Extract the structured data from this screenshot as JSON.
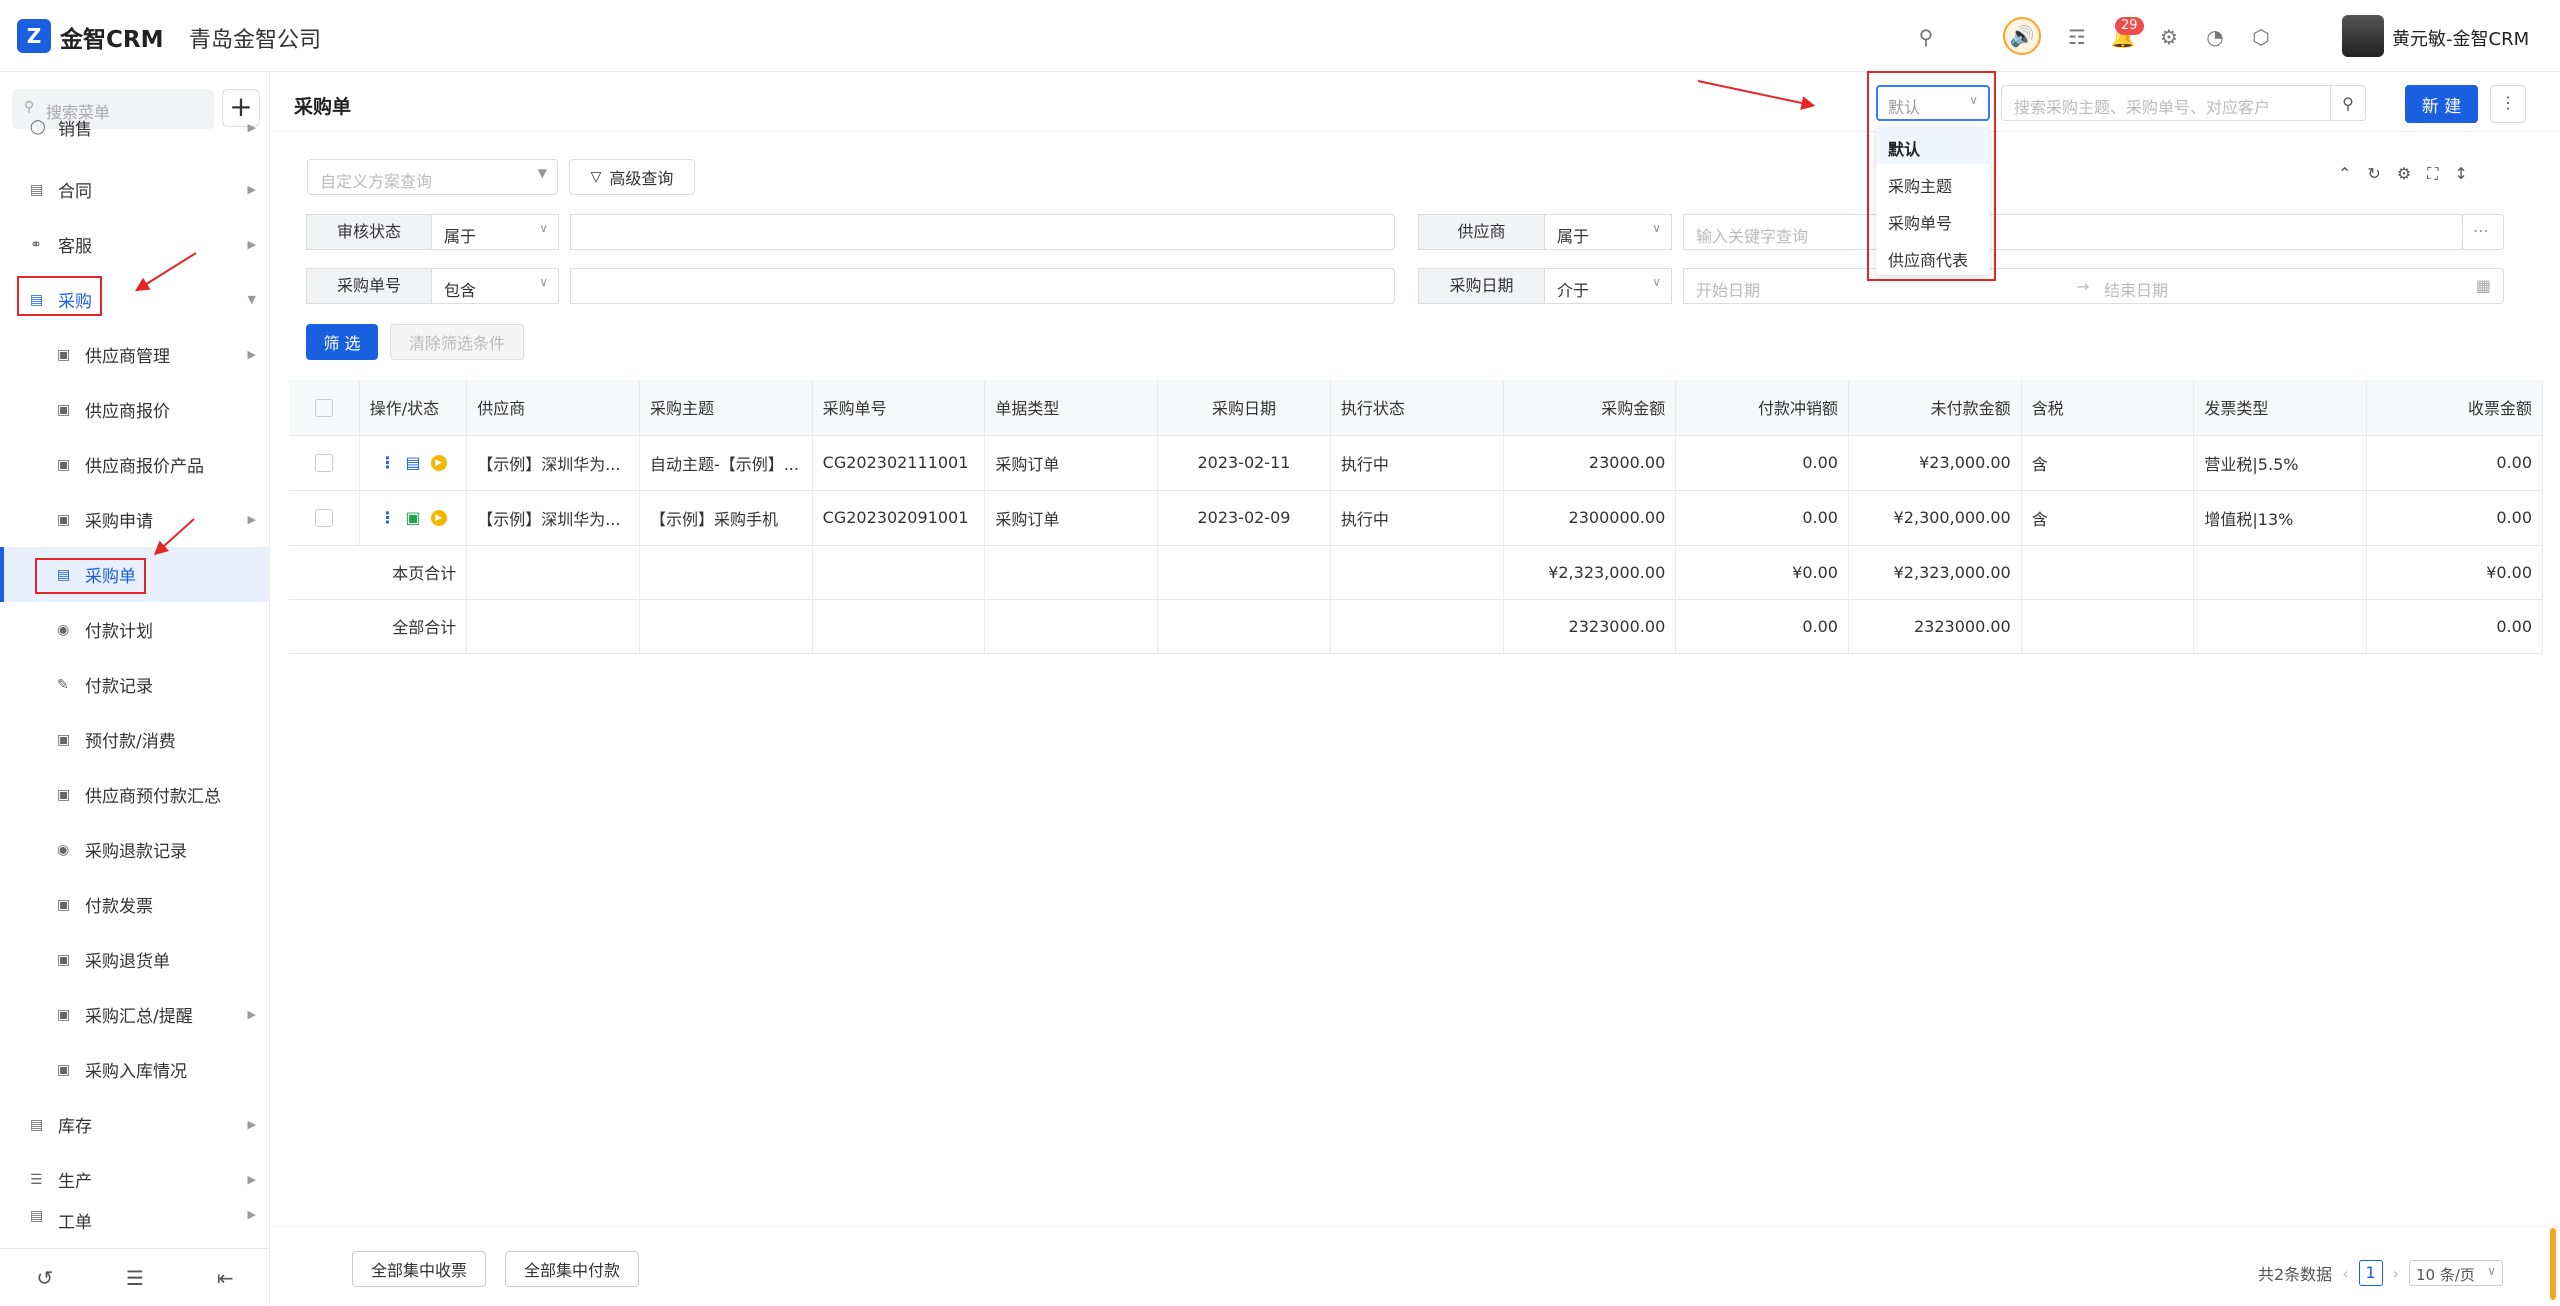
{
  "app": {
    "logo_letter": "Z",
    "name": "金智CRM",
    "company": "青岛金智公司",
    "notification_count": "29",
    "user_name": "黄元敏-金智CRM"
  },
  "sidebar": {
    "search_placeholder": "搜索菜单",
    "items": [
      {
        "label": "销售"
      },
      {
        "label": "合同"
      },
      {
        "label": "客服"
      },
      {
        "label": "采购"
      },
      {
        "label": "供应商管理"
      },
      {
        "label": "供应商报价"
      },
      {
        "label": "供应商报价产品"
      },
      {
        "label": "采购申请"
      },
      {
        "label": "采购单"
      },
      {
        "label": "付款计划"
      },
      {
        "label": "付款记录"
      },
      {
        "label": "预付款/消费"
      },
      {
        "label": "供应商预付款汇总"
      },
      {
        "label": "采购退款记录"
      },
      {
        "label": "付款发票"
      },
      {
        "label": "采购退货单"
      },
      {
        "label": "采购汇总/提醒"
      },
      {
        "label": "采购入库情况"
      },
      {
        "label": "库存"
      },
      {
        "label": "生产"
      },
      {
        "label": "工单"
      }
    ]
  },
  "header": {
    "title": "采购单",
    "search_field_selected": "默认",
    "search_placeholder": "搜索采购主题、采购单号、对应客户",
    "new_button": "新 建",
    "dropdown_options": [
      "默认",
      "采购主题",
      "采购单号",
      "供应商代表"
    ]
  },
  "filters": {
    "scheme_placeholder": "自定义方案查询",
    "advanced_button": "高级查询",
    "rows": [
      {
        "label": "审核状态",
        "op": "属于",
        "value": ""
      },
      {
        "label": "供应商",
        "op": "属于",
        "value": "输入关键字查询"
      },
      {
        "label": "采购单号",
        "op": "包含",
        "value": ""
      },
      {
        "label": "采购日期",
        "op": "介于",
        "start": "开始日期",
        "end": "结束日期"
      }
    ],
    "filter_button": "筛 选",
    "clear_button": "清除筛选条件"
  },
  "table": {
    "columns": [
      "操作/状态",
      "供应商",
      "采购主题",
      "采购单号",
      "单据类型",
      "采购日期",
      "执行状态",
      "采购金额",
      "付款冲销额",
      "未付款金额",
      "含税",
      "发票类型",
      "收票金额"
    ],
    "rows": [
      {
        "supplier": "【示例】深圳华为...",
        "subject": "自动主题-【示例】...",
        "no": "CG202302111001",
        "type": "采购订单",
        "date": "2023-02-11",
        "status": "执行中",
        "amount": "23000.00",
        "offset": "0.00",
        "unpaid": "¥23,000.00",
        "tax": "含",
        "invoice_type": "营业税|5.5%",
        "received": "0.00"
      },
      {
        "supplier": "【示例】深圳华为...",
        "subject": "【示例】采购手机",
        "no": "CG202302091001",
        "type": "采购订单",
        "date": "2023-02-09",
        "status": "执行中",
        "amount": "2300000.00",
        "offset": "0.00",
        "unpaid": "¥2,300,000.00",
        "tax": "含",
        "invoice_type": "增值税|13%",
        "received": "0.00"
      }
    ],
    "page_total": {
      "label": "本页合计",
      "amount": "¥2,323,000.00",
      "offset": "¥0.00",
      "unpaid": "¥2,323,000.00",
      "received": "¥0.00"
    },
    "all_total": {
      "label": "全部合计",
      "amount": "2323000.00",
      "offset": "0.00",
      "unpaid": "2323000.00",
      "received": "0.00"
    }
  },
  "footer": {
    "collect_button": "全部集中收票",
    "pay_button": "全部集中付款",
    "total_text": "共2条数据",
    "page": "1",
    "page_size": "10 条/页"
  },
  "colors": {
    "accent": "#1a5fe0",
    "annotation": "#e52626",
    "positive": "#19a84a"
  }
}
